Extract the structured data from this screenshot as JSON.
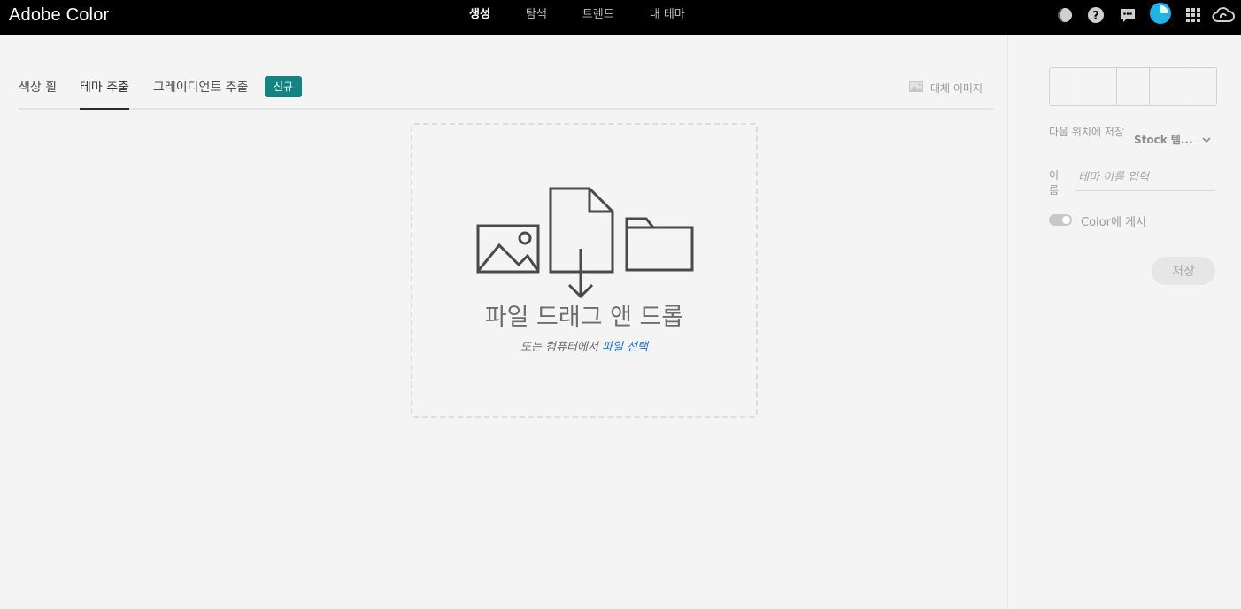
{
  "app": {
    "title": "Adobe Color"
  },
  "topnav": [
    "생성",
    "탐색",
    "트렌드",
    "내 테마"
  ],
  "top_icons": [
    "dark-mode-icon",
    "help-icon",
    "feedback-icon",
    "avatar",
    "apps-grid-icon",
    "creative-cloud-icon"
  ],
  "tabs": {
    "color_wheel": "색상 휠",
    "extract_theme": "테마 추출",
    "extract_gradient": "그레이디언트 추출",
    "new_badge": "신규"
  },
  "alt_image": "대체 이미지",
  "dropzone": {
    "title": "파일 드래그 앤 드롭",
    "subtitle_prefix": "또는 컴퓨터에서",
    "subtitle_link": "파일 선택"
  },
  "panel": {
    "save_to_label": "다음 위치에 저장",
    "save_to_value": "Stock 템...",
    "name_label": "이름",
    "name_placeholder": "테마 이름 입력",
    "publish_label": "Color에 게시",
    "save_button": "저장"
  },
  "colors": {
    "topbar": "#000000",
    "accent": "#168383",
    "link": "#1473e6",
    "avatar": "#1fb3e8"
  }
}
